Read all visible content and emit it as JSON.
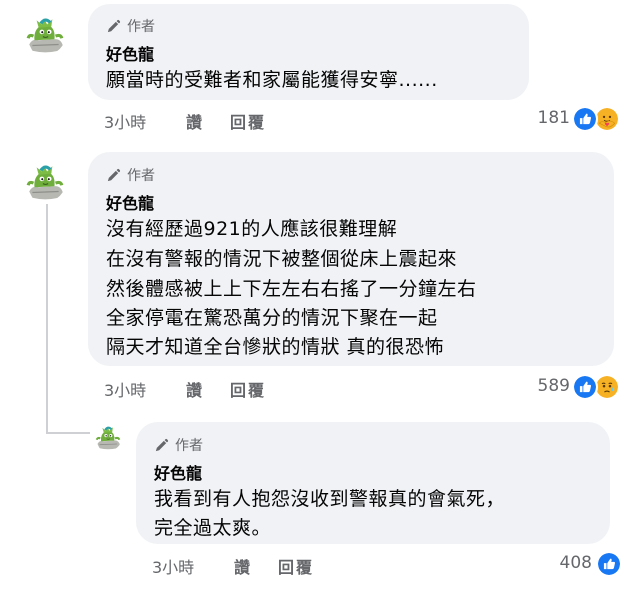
{
  "comments": [
    {
      "author_tag": "作者",
      "name": "好色龍",
      "lines": [
        "願當時的受難者和家屬能獲得安寧......"
      ],
      "time": "3小時",
      "like_label": "讚",
      "reply_label": "回覆",
      "reaction_count": "181",
      "reactions": [
        "like-icon",
        "care-icon"
      ]
    },
    {
      "author_tag": "作者",
      "name": "好色龍",
      "lines": [
        "沒有經歷過921的人應該很難理解",
        "在沒有警報的情況下被整個從床上震起來",
        "然後體感被上上下左左右右搖了一分鐘左右",
        "全家停電在驚恐萬分的情況下聚在一起",
        "隔天才知道全台慘狀的情狀 真的很恐怖"
      ],
      "time": "3小時",
      "like_label": "讚",
      "reply_label": "回覆",
      "reaction_count": "589",
      "reactions": [
        "like-icon",
        "sad-icon"
      ]
    },
    {
      "author_tag": "作者",
      "name": "好色龍",
      "lines": [
        "我看到有人抱怨沒收到警報真的會氣死，",
        "完全過太爽。"
      ],
      "time": "3小時",
      "like_label": "讚",
      "reply_label": "回覆",
      "reaction_count": "408",
      "reactions": [
        "like-icon"
      ]
    }
  ],
  "colors": {
    "bubble": "#f0f2f5",
    "muted_text": "#65676b",
    "like_blue": "#1877f2",
    "reaction_yellow": "#f7b125"
  }
}
